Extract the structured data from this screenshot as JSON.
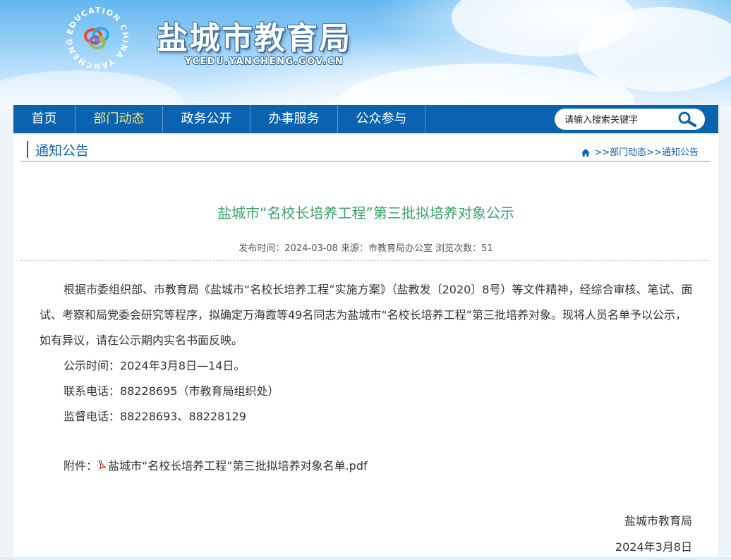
{
  "header": {
    "site_title": "盐城市教育局",
    "site_url": "YCEDU.YANCHENG.GOV.CN",
    "logo_ring_text": "EDUCATION CHINA YANCHENG",
    "logo_icon": "education-logo"
  },
  "nav": {
    "items": [
      {
        "label": "首页",
        "active": false
      },
      {
        "label": "部门动态",
        "active": true
      },
      {
        "label": "政务公开",
        "active": false
      },
      {
        "label": "办事服务",
        "active": false
      },
      {
        "label": "公众参与",
        "active": false
      }
    ],
    "search": {
      "placeholder": "请输入搜索关键字",
      "icon": "search-icon"
    }
  },
  "section": {
    "title": "通知公告",
    "breadcrumb": {
      "home_icon": "home-icon",
      "prefix": ">>",
      "level1": "部门动态",
      "sep": ">>",
      "level2": "通知公告"
    }
  },
  "article": {
    "title": "盐城市“名校长培养工程”第三批拟培养对象公示",
    "meta": "发布时间：2024-03-08 来源：市教育局办公室 浏览次数：51",
    "paragraph": "根据市委组织部、市教育局《盐城市“名校长培养工程”实施方案》（盐教发〔2020〕8号）等文件精神，经综合审核、笔试、面试、考察和局党委会研究等程序，拟确定万海霞等49名同志为盐城市“名校长培养工程”第三批培养对象。现将人员名单予以公示，如有异议，请在公示期内实名书面反映。",
    "lines": [
      "公示时间：2024年3月8日—14日。",
      "联系电话：88228695（市教育局组织处）",
      "监督电话：88228693、88228129"
    ],
    "attachment_label": "附件：",
    "attachment_file": "盐城市“名校长培养工程”第三批拟培养对象名单.pdf",
    "attachment_icon": "pdf-icon",
    "signature": "盐城市教育局",
    "date": "2024年3月8日"
  },
  "colors": {
    "nav_bg": "#0b63b0",
    "nav_active": "#ffe66a",
    "title_green": "#3aa36a",
    "link_blue": "#0b63b0"
  }
}
